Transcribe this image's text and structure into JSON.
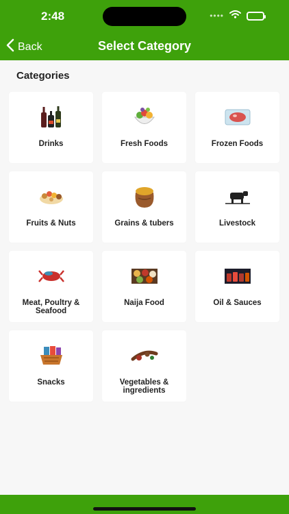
{
  "status_bar": {
    "time": "2:48",
    "signal": "••••"
  },
  "header": {
    "back_label": "Back",
    "title": "Select Category"
  },
  "section_title": "Categories",
  "categories": [
    {
      "label": "Drinks",
      "icon": "bottles-icon"
    },
    {
      "label": "Fresh Foods",
      "icon": "salad-bowl-icon"
    },
    {
      "label": "Frozen Foods",
      "icon": "frozen-meat-icon"
    },
    {
      "label": "Fruits & Nuts",
      "icon": "fruit-nut-platter-icon"
    },
    {
      "label": "Grains & tubers",
      "icon": "grain-sack-icon"
    },
    {
      "label": "Livestock",
      "icon": "cow-icon"
    },
    {
      "label": "Meat, Poultry & Seafood",
      "icon": "lobster-icon"
    },
    {
      "label": "Naija Food",
      "icon": "dishes-icon"
    },
    {
      "label": "Oil & Sauces",
      "icon": "sauce-jars-icon"
    },
    {
      "label": "Snacks",
      "icon": "snack-basket-icon"
    },
    {
      "label": "Vegetables & ingredients",
      "icon": "spices-icon"
    }
  ],
  "colors": {
    "header_green": "#3ea10b",
    "background": "#f7f7f7",
    "card": "#ffffff"
  }
}
